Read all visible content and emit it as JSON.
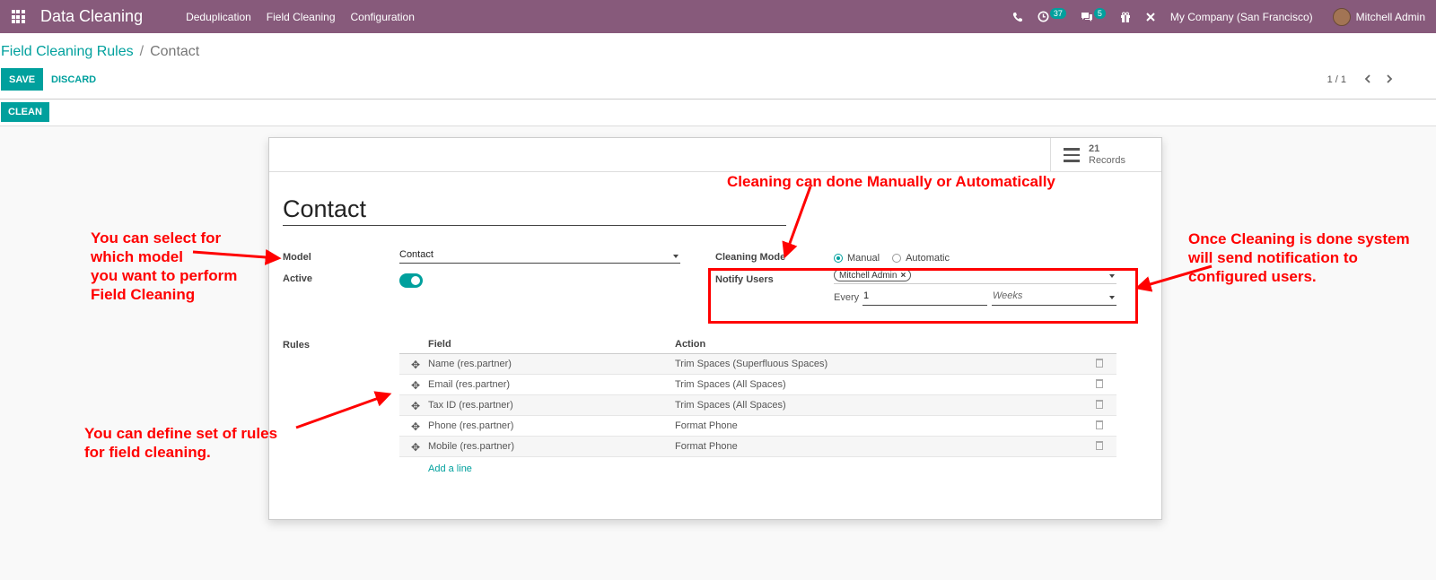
{
  "navbar": {
    "app_name": "Data Cleaning",
    "menu": [
      "Deduplication",
      "Field Cleaning",
      "Configuration"
    ],
    "activity_count": "37",
    "message_count": "5",
    "company": "My Company (San Francisco)",
    "user": "Mitchell Admin"
  },
  "control_panel": {
    "breadcrumb_parent": "Field Cleaning Rules",
    "breadcrumb_current": "Contact",
    "save_label": "SAVE",
    "discard_label": "DISCARD",
    "pager": "1 / 1",
    "clean_label": "CLEAN"
  },
  "form": {
    "records_count": "21",
    "records_label": "Records",
    "name": "Contact",
    "model_label": "Model",
    "model_value": "Contact",
    "active_label": "Active",
    "active": true,
    "cleaning_mode_label": "Cleaning Mode",
    "mode_options": [
      "Manual",
      "Automatic"
    ],
    "mode_selected": "Manual",
    "notify_label": "Notify Users",
    "notify_user_tag": "Mitchell Admin",
    "every_label": "Every",
    "every_value": "1",
    "period_value": "Weeks",
    "rules_label": "Rules",
    "rules_headers": {
      "field": "Field",
      "action": "Action"
    },
    "rules": [
      {
        "field": "Name (res.partner)",
        "action": "Trim Spaces (Superfluous Spaces)"
      },
      {
        "field": "Email (res.partner)",
        "action": "Trim Spaces (All Spaces)"
      },
      {
        "field": "Tax ID (res.partner)",
        "action": "Trim Spaces (All Spaces)"
      },
      {
        "field": "Phone (res.partner)",
        "action": "Format Phone"
      },
      {
        "field": "Mobile (res.partner)",
        "action": "Format Phone"
      }
    ],
    "add_line": "Add a line"
  },
  "annotations": {
    "model_note": [
      "You can select for",
      "which model",
      "you want to perform",
      "Field Cleaning"
    ],
    "mode_note": "Cleaning can done Manually or Automatically",
    "notify_note": [
      "Once Cleaning is done system",
      "will send notification to",
      "configured users."
    ],
    "rules_note": [
      "You can define set of rules",
      "for field cleaning."
    ]
  },
  "colors": {
    "navbar": "#875a7b",
    "accent": "#00a09d",
    "annotation": "#ff0000"
  }
}
